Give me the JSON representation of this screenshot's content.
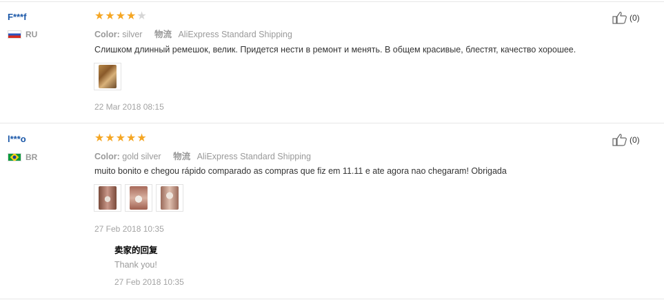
{
  "reviews": [
    {
      "user": "F***f",
      "country_code": "RU",
      "rating": 4,
      "rating_max": 5,
      "color_label": "Color:",
      "color_value": "silver",
      "shipping_label": "物流",
      "shipping_value": "AliExpress Standard Shipping",
      "text": "Слишком длинный ремешок, велик. Придется нести в ремонт и менять. В общем красивые, блестят, качество хорошее.",
      "photo_count": 1,
      "date": "22 Mar 2018 08:15",
      "likes": "(0)"
    },
    {
      "user": "l***o",
      "country_code": "BR",
      "rating": 5,
      "rating_max": 5,
      "color_label": "Color:",
      "color_value": "gold silver",
      "shipping_label": "物流",
      "shipping_value": "AliExpress Standard Shipping",
      "text": "muito bonito e chegou rápido comparado as compras que fiz em 11.11 e ate agora nao chegaram! Obrigada",
      "photo_count": 3,
      "date": "27 Feb 2018 10:35",
      "likes": "(0)",
      "seller_reply": {
        "title": "卖家的回复",
        "text": "Thank you!",
        "date": "27 Feb 2018 10:35"
      }
    }
  ],
  "colors": {
    "username": "#1a57a8",
    "star_on": "#f5a623",
    "star_off": "#d6d6d6",
    "muted": "#999999"
  },
  "icons": {
    "like": "thumbs-up-icon",
    "flag_ru": "russia-flag-icon",
    "flag_br": "brazil-flag-icon",
    "photo": "review-photo-thumbnail"
  }
}
